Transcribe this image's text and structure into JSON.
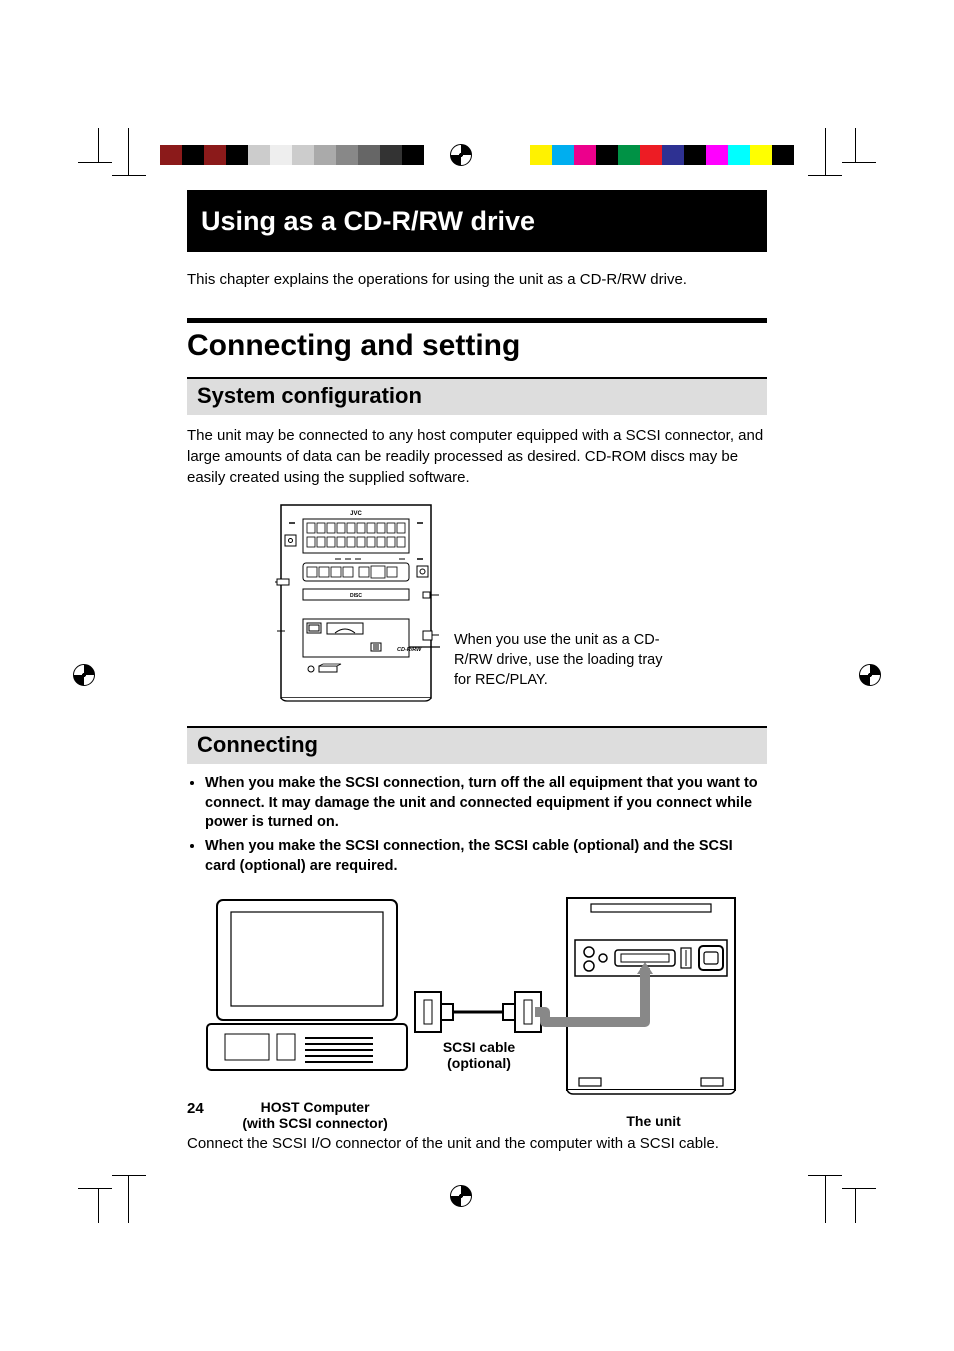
{
  "page_number": "24",
  "chapter_title": "Using as a CD-R/RW drive",
  "intro": "This chapter explains the operations for using the unit as a CD-R/RW drive.",
  "section_heading": "Connecting and setting",
  "sub1": {
    "heading": "System configuration",
    "body": "The unit may be connected to any host computer equipped with a SCSI connector, and large amounts of data can be readily processed as desired. CD-ROM discs may be easily created using the supplied software.",
    "callout": "When you use the unit as a CD-R/RW drive, use the loading tray for REC/PLAY.",
    "device_label_top": "JVC",
    "device_label_bottom": "CD-R/RW"
  },
  "sub2": {
    "heading": "Connecting",
    "notes": [
      "When you make the SCSI connection, turn off the all equipment that you want to connect. It may damage the unit and connected equipment if you connect while power is turned on.",
      "When you make the SCSI connection, the SCSI cable (optional) and the SCSI card (optional) are required."
    ],
    "labels": {
      "host": "HOST Computer",
      "host_sub": "(with SCSI connector)",
      "cable": "SCSI cable",
      "cable_sub": "(optional)",
      "unit": "The unit"
    },
    "final": "Connect the SCSI I/O connector of the unit and the computer with a SCSI cable."
  },
  "colorbar_left": [
    "#8b1a1a",
    "#000",
    "#8b1a1a",
    "#000",
    "#ccc",
    "#eee",
    "#ccc",
    "#aaa",
    "#888",
    "#666",
    "#333",
    "#000"
  ],
  "colorbar_right": [
    "#fff200",
    "#00aeef",
    "#ec008c",
    "#000",
    "#009245",
    "#ed1c24",
    "#2e3192",
    "#000",
    "#ff00ff",
    "#00ffff",
    "#ff0",
    "#000"
  ]
}
